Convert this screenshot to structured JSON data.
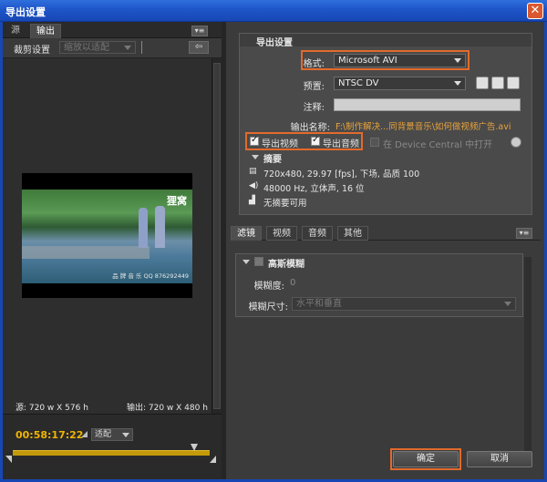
{
  "window": {
    "title": "导出设置",
    "close_glyph": "✕"
  },
  "left": {
    "tabs": [
      {
        "label": "源"
      },
      {
        "label": "输出"
      }
    ],
    "crop_label": "裁剪设置",
    "crop_select": "缩放以适配",
    "source_info": "源: 720 w X 576 h",
    "output_info": "输出: 720 w X 480 h",
    "watermark_top": "狸窝",
    "watermark_bottom": "品  牌  音  乐  QQ  876292449",
    "timecode": "00:58:17:22",
    "fit_select": "适配"
  },
  "export": {
    "section_title": "导出设置",
    "format_label": "格式:",
    "format_value": "Microsoft AVI",
    "preset_label": "预置:",
    "preset_value": "NTSC DV",
    "comment_label": "注释:",
    "comment_value": "",
    "output_label": "输出名称:",
    "output_value": "F:\\制作解决...同背景音乐\\如何做视频广告.avi",
    "export_video_label": "导出视频",
    "export_audio_label": "导出音频",
    "device_central_label": "在 Device Central 中打开",
    "summary_title": "摘要",
    "summary_video": "720x480, 29.97 [fps], 下场, 品质 100",
    "summary_audio": "48000 Hz, 立体声, 16 位",
    "summary_meta": "无摘要可用"
  },
  "filters": {
    "tabs": [
      {
        "label": "滤镜"
      },
      {
        "label": "视频"
      },
      {
        "label": "音频"
      },
      {
        "label": "其他"
      }
    ],
    "section_title": "高斯模糊",
    "blurriness_label": "模糊度:",
    "blurriness_value": "0",
    "blur_dimension_label": "模糊尺寸:",
    "blur_dimension_value": "水平和垂直"
  },
  "buttons": {
    "ok": "确定",
    "cancel": "取消"
  },
  "colors": {
    "highlight": "#e26a2c",
    "timecode": "#f0b400",
    "titlebar": "#1e55c8"
  }
}
